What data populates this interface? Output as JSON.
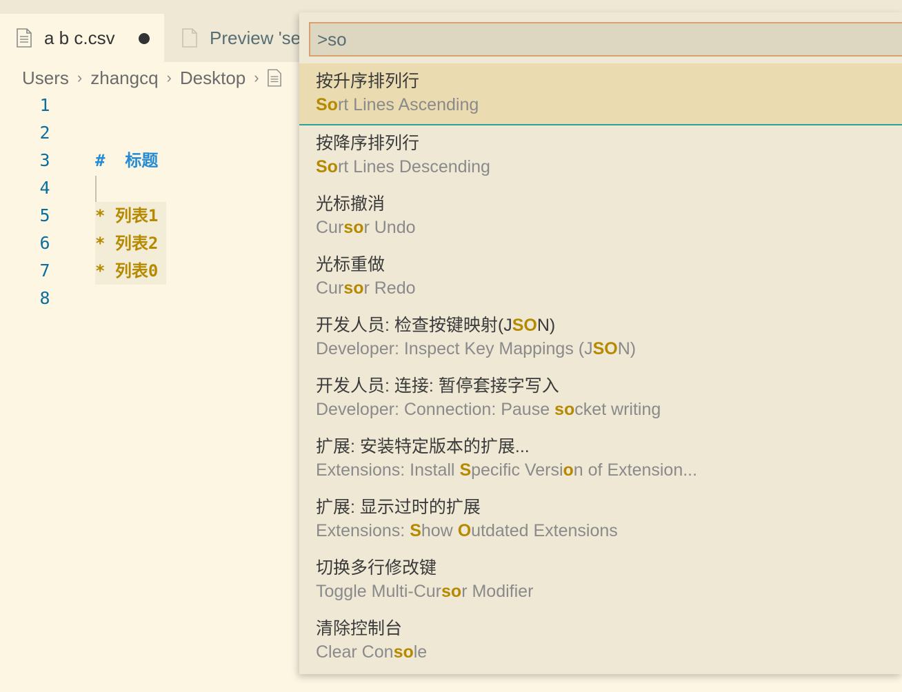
{
  "tabs": [
    {
      "label": "a b c.csv",
      "dirty": true,
      "active": true
    },
    {
      "label": "Preview 'se",
      "active": false
    }
  ],
  "breadcrumb": [
    "Users",
    "zhangcq",
    "Desktop"
  ],
  "editor": {
    "lines": [
      {
        "number": "1",
        "text": ""
      },
      {
        "number": "2",
        "text": ""
      },
      {
        "number": "3",
        "text": "#  标题"
      },
      {
        "number": "4",
        "text": ""
      },
      {
        "number": "5",
        "text": "* 列表1"
      },
      {
        "number": "6",
        "text": "* 列表2"
      },
      {
        "number": "7",
        "text": "* 列表0"
      },
      {
        "number": "8",
        "text": ""
      }
    ]
  },
  "command_palette": {
    "query": ">so",
    "items": [
      {
        "label": "按升序排列行",
        "detail": "Sort Lines Ascending",
        "label_hl": "",
        "detail_hl": "So",
        "selected": true
      },
      {
        "label": "按降序排列行",
        "detail": "Sort Lines Descending",
        "label_hl": "",
        "detail_hl": "So"
      },
      {
        "label": "光标撤消",
        "detail": "Cursor Undo",
        "label_hl": "",
        "detail_hl": "so"
      },
      {
        "label": "光标重做",
        "detail": "Cursor Redo",
        "label_hl": "",
        "detail_hl": "so"
      },
      {
        "label": "开发人员: 检查按键映射(JSON)",
        "detail": "Developer: Inspect Key Mappings (JSON)",
        "label_hl": "SO",
        "detail_hl": "SO"
      },
      {
        "label": "开发人员: 连接: 暂停套接字写入",
        "detail": "Developer: Connection: Pause socket writing",
        "label_hl": "",
        "detail_hl": "so"
      },
      {
        "label": "扩展: 安装特定版本的扩展...",
        "detail": "Extensions: Install Specific Version of Extension...",
        "label_hl": "",
        "detail_hl": "S|o"
      },
      {
        "label": "扩展: 显示过时的扩展",
        "detail": "Extensions: Show Outdated Extensions",
        "label_hl": "",
        "detail_hl": "S|O"
      },
      {
        "label": "切换多行修改键",
        "detail": "Toggle Multi-Cursor Modifier",
        "label_hl": "",
        "detail_hl": "so"
      },
      {
        "label": "清除控制台",
        "detail": "Clear Console",
        "label_hl": "",
        "detail_hl": "so"
      }
    ]
  },
  "colors": {
    "background": "#fdf6e3",
    "tabbar": "#eee8d5",
    "highlight": "#b58900",
    "line_number": "#0a6ea0",
    "heading": "#268bd2",
    "focus_border": "#d9a06f",
    "selection_bg": "#eadbb0",
    "selection_border": "#2aa198"
  }
}
